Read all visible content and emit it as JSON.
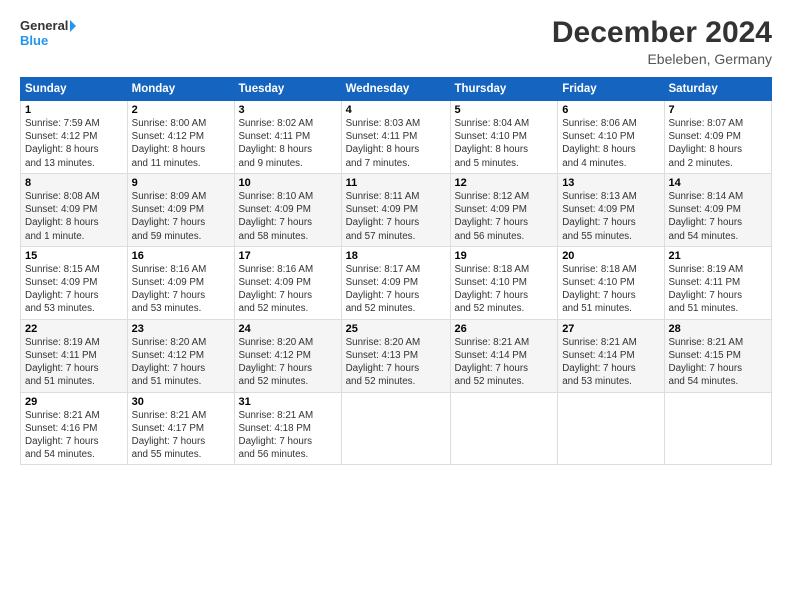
{
  "header": {
    "logo_line1": "General",
    "logo_line2": "Blue",
    "main_title": "December 2024",
    "subtitle": "Ebeleben, Germany"
  },
  "calendar": {
    "days_of_week": [
      "Sunday",
      "Monday",
      "Tuesday",
      "Wednesday",
      "Thursday",
      "Friday",
      "Saturday"
    ],
    "weeks": [
      [
        {
          "day": "1",
          "info": "Sunrise: 7:59 AM\nSunset: 4:12 PM\nDaylight: 8 hours\nand 13 minutes."
        },
        {
          "day": "2",
          "info": "Sunrise: 8:00 AM\nSunset: 4:12 PM\nDaylight: 8 hours\nand 11 minutes."
        },
        {
          "day": "3",
          "info": "Sunrise: 8:02 AM\nSunset: 4:11 PM\nDaylight: 8 hours\nand 9 minutes."
        },
        {
          "day": "4",
          "info": "Sunrise: 8:03 AM\nSunset: 4:11 PM\nDaylight: 8 hours\nand 7 minutes."
        },
        {
          "day": "5",
          "info": "Sunrise: 8:04 AM\nSunset: 4:10 PM\nDaylight: 8 hours\nand 5 minutes."
        },
        {
          "day": "6",
          "info": "Sunrise: 8:06 AM\nSunset: 4:10 PM\nDaylight: 8 hours\nand 4 minutes."
        },
        {
          "day": "7",
          "info": "Sunrise: 8:07 AM\nSunset: 4:09 PM\nDaylight: 8 hours\nand 2 minutes."
        }
      ],
      [
        {
          "day": "8",
          "info": "Sunrise: 8:08 AM\nSunset: 4:09 PM\nDaylight: 8 hours\nand 1 minute."
        },
        {
          "day": "9",
          "info": "Sunrise: 8:09 AM\nSunset: 4:09 PM\nDaylight: 7 hours\nand 59 minutes."
        },
        {
          "day": "10",
          "info": "Sunrise: 8:10 AM\nSunset: 4:09 PM\nDaylight: 7 hours\nand 58 minutes."
        },
        {
          "day": "11",
          "info": "Sunrise: 8:11 AM\nSunset: 4:09 PM\nDaylight: 7 hours\nand 57 minutes."
        },
        {
          "day": "12",
          "info": "Sunrise: 8:12 AM\nSunset: 4:09 PM\nDaylight: 7 hours\nand 56 minutes."
        },
        {
          "day": "13",
          "info": "Sunrise: 8:13 AM\nSunset: 4:09 PM\nDaylight: 7 hours\nand 55 minutes."
        },
        {
          "day": "14",
          "info": "Sunrise: 8:14 AM\nSunset: 4:09 PM\nDaylight: 7 hours\nand 54 minutes."
        }
      ],
      [
        {
          "day": "15",
          "info": "Sunrise: 8:15 AM\nSunset: 4:09 PM\nDaylight: 7 hours\nand 53 minutes."
        },
        {
          "day": "16",
          "info": "Sunrise: 8:16 AM\nSunset: 4:09 PM\nDaylight: 7 hours\nand 53 minutes."
        },
        {
          "day": "17",
          "info": "Sunrise: 8:16 AM\nSunset: 4:09 PM\nDaylight: 7 hours\nand 52 minutes."
        },
        {
          "day": "18",
          "info": "Sunrise: 8:17 AM\nSunset: 4:09 PM\nDaylight: 7 hours\nand 52 minutes."
        },
        {
          "day": "19",
          "info": "Sunrise: 8:18 AM\nSunset: 4:10 PM\nDaylight: 7 hours\nand 52 minutes."
        },
        {
          "day": "20",
          "info": "Sunrise: 8:18 AM\nSunset: 4:10 PM\nDaylight: 7 hours\nand 51 minutes."
        },
        {
          "day": "21",
          "info": "Sunrise: 8:19 AM\nSunset: 4:11 PM\nDaylight: 7 hours\nand 51 minutes."
        }
      ],
      [
        {
          "day": "22",
          "info": "Sunrise: 8:19 AM\nSunset: 4:11 PM\nDaylight: 7 hours\nand 51 minutes."
        },
        {
          "day": "23",
          "info": "Sunrise: 8:20 AM\nSunset: 4:12 PM\nDaylight: 7 hours\nand 51 minutes."
        },
        {
          "day": "24",
          "info": "Sunrise: 8:20 AM\nSunset: 4:12 PM\nDaylight: 7 hours\nand 52 minutes."
        },
        {
          "day": "25",
          "info": "Sunrise: 8:20 AM\nSunset: 4:13 PM\nDaylight: 7 hours\nand 52 minutes."
        },
        {
          "day": "26",
          "info": "Sunrise: 8:21 AM\nSunset: 4:14 PM\nDaylight: 7 hours\nand 52 minutes."
        },
        {
          "day": "27",
          "info": "Sunrise: 8:21 AM\nSunset: 4:14 PM\nDaylight: 7 hours\nand 53 minutes."
        },
        {
          "day": "28",
          "info": "Sunrise: 8:21 AM\nSunset: 4:15 PM\nDaylight: 7 hours\nand 54 minutes."
        }
      ],
      [
        {
          "day": "29",
          "info": "Sunrise: 8:21 AM\nSunset: 4:16 PM\nDaylight: 7 hours\nand 54 minutes."
        },
        {
          "day": "30",
          "info": "Sunrise: 8:21 AM\nSunset: 4:17 PM\nDaylight: 7 hours\nand 55 minutes."
        },
        {
          "day": "31",
          "info": "Sunrise: 8:21 AM\nSunset: 4:18 PM\nDaylight: 7 hours\nand 56 minutes."
        },
        {
          "day": "",
          "info": ""
        },
        {
          "day": "",
          "info": ""
        },
        {
          "day": "",
          "info": ""
        },
        {
          "day": "",
          "info": ""
        }
      ]
    ]
  }
}
